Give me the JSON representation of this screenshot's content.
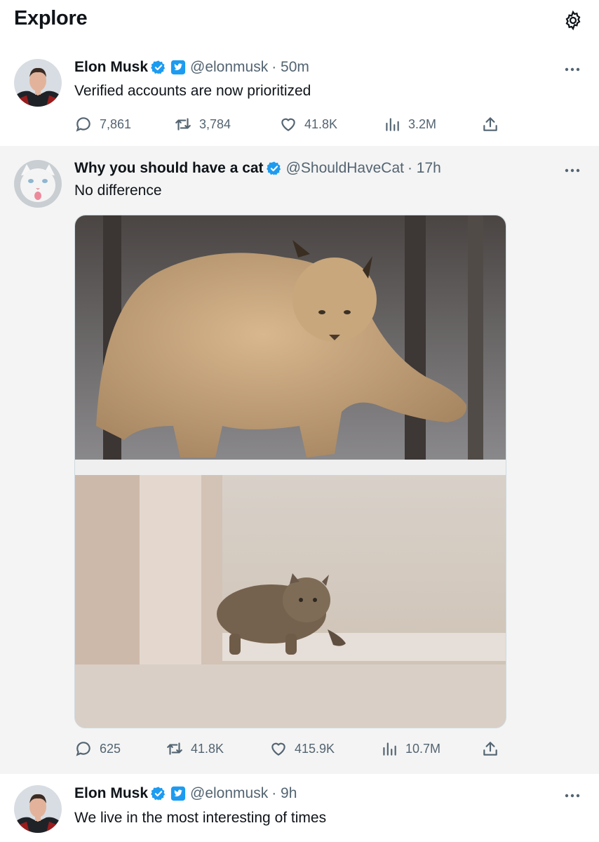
{
  "header": {
    "title": "Explore"
  },
  "tweets": [
    {
      "name": "Elon Musk",
      "handle": "@elonmusk",
      "time": "· 50m",
      "text": "Verified accounts are now prioritized",
      "stats": {
        "replies": "7,861",
        "retweets": "3,784",
        "likes": "41.8K",
        "views": "3.2M"
      }
    },
    {
      "name": "Why you should have a cat",
      "handle": "@ShouldHaveCat",
      "time": "· 17h",
      "text": "No difference",
      "stats": {
        "replies": "625",
        "retweets": "41.8K",
        "likes": "415.9K",
        "views": "10.7M"
      }
    },
    {
      "name": "Elon Musk",
      "handle": "@elonmusk",
      "time": "· 9h",
      "text": "We live in the most interesting of times"
    }
  ],
  "colors": {
    "verified": "#1d9bf0",
    "muted": "#536471",
    "text": "#0f1419",
    "gray_bg": "#f4f4f4"
  },
  "icons": [
    "gear-icon",
    "verified-badge-icon",
    "affiliate-badge-icon",
    "more-icon",
    "reply-icon",
    "retweet-icon",
    "like-icon",
    "views-icon",
    "share-icon"
  ]
}
